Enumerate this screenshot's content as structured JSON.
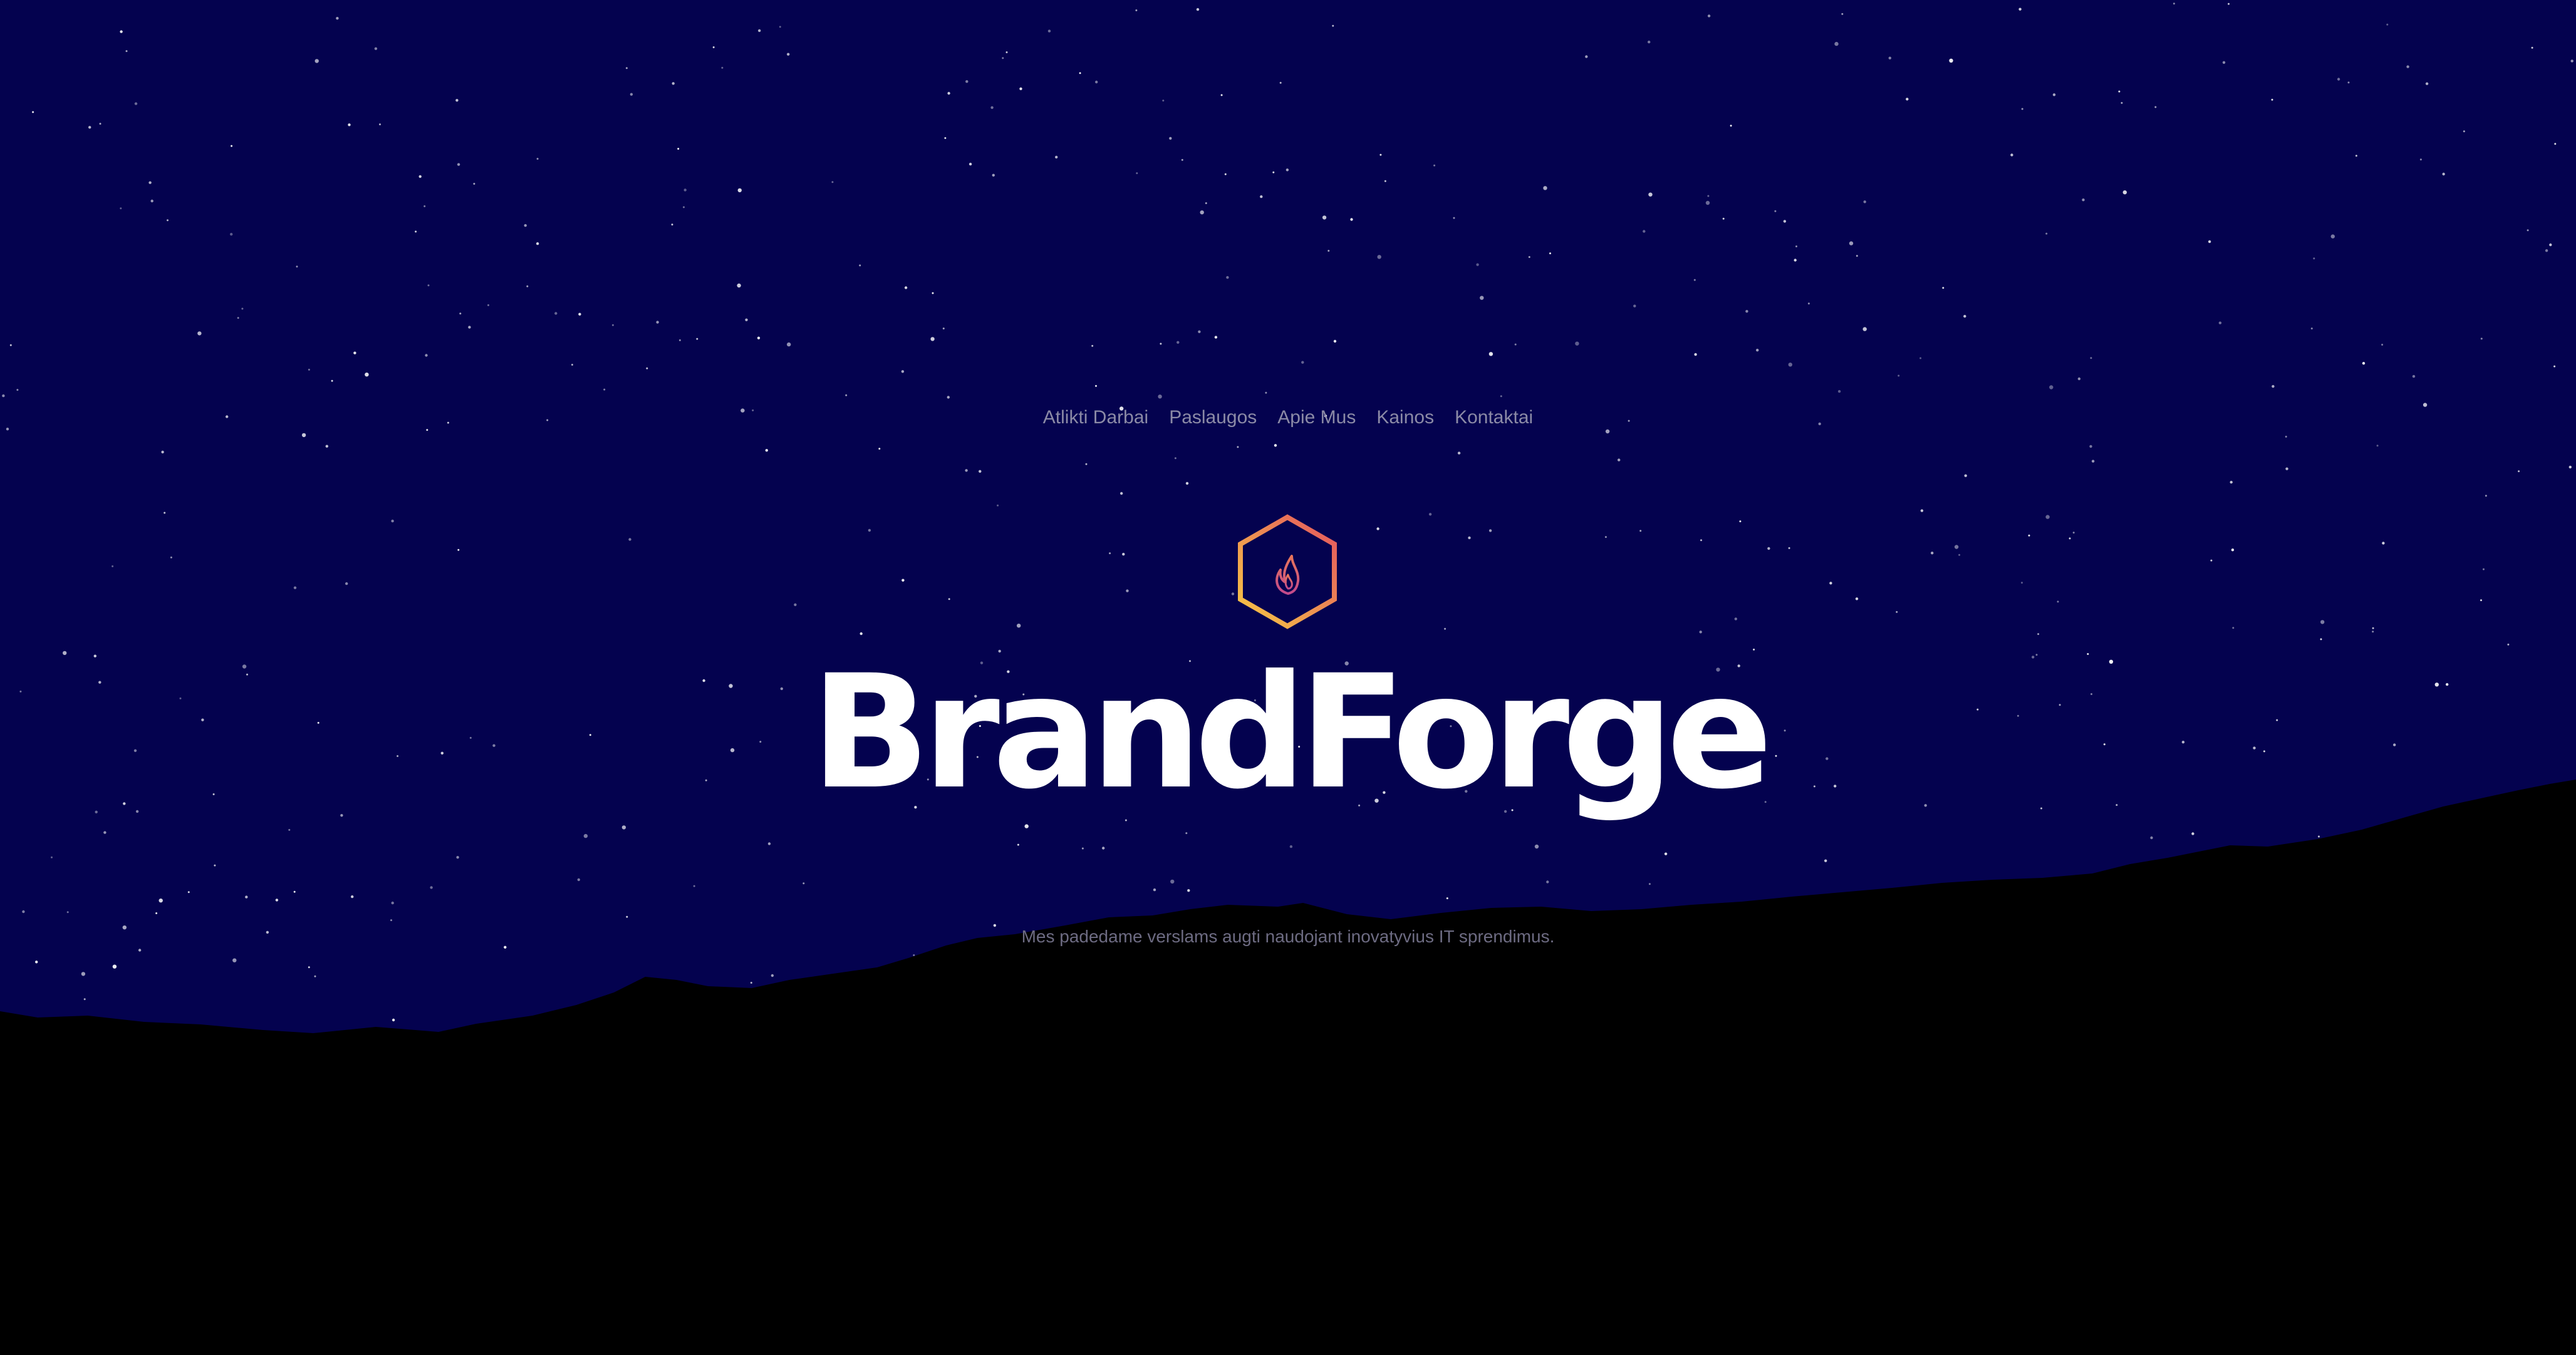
{
  "nav": {
    "items": [
      {
        "label": "Atlikti Darbai"
      },
      {
        "label": "Paslaugos"
      },
      {
        "label": "Apie Mus"
      },
      {
        "label": "Kainos"
      },
      {
        "label": "Kontaktai"
      }
    ]
  },
  "hero": {
    "logo_icon": "hexagon-flame-icon",
    "title": "BrandForge",
    "tagline": "Mes padedame verslams augti naudojant inovatyvius IT sprendimus."
  },
  "colors": {
    "sky": "#04024f",
    "mountains": "#000000",
    "title": "#ffffff",
    "nav_text": "#8b8aa6",
    "tagline_text": "#6d6b82",
    "logo_gradient_start": "#f7c945",
    "logo_gradient_end": "#e3545f"
  }
}
